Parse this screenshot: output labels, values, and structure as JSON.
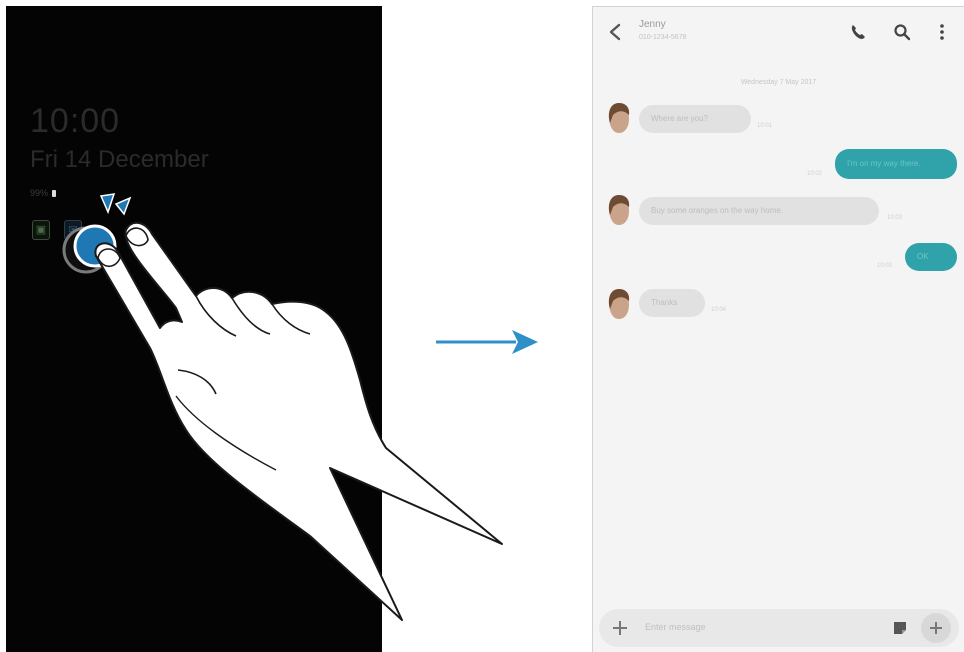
{
  "aod": {
    "time": "10:00",
    "date": "Fri 14 December",
    "battery_text": "99%"
  },
  "messages": {
    "header": {
      "contact_name": "Jenny",
      "contact_number": "010-1234-5678"
    },
    "date_separator": "Wednesday 7 May 2017",
    "conversation": [
      {
        "direction": "in",
        "text": "Where are you?",
        "time": "10:01"
      },
      {
        "direction": "out",
        "text": "I'm on my way there.",
        "time": "10:02"
      },
      {
        "direction": "in",
        "text": "Buy some oranges on the way home.",
        "time": "10:03"
      },
      {
        "direction": "out",
        "text": "OK",
        "time": "10:03"
      },
      {
        "direction": "in",
        "text": "Thanks",
        "time": "10:04"
      }
    ],
    "input": {
      "placeholder": "Enter message"
    }
  },
  "colors": {
    "outgoing_bubble": "#2fa3a9",
    "incoming_bubble": "#e1e1e1",
    "arrow": "#2f8fc9",
    "aod_background": "#040404"
  }
}
